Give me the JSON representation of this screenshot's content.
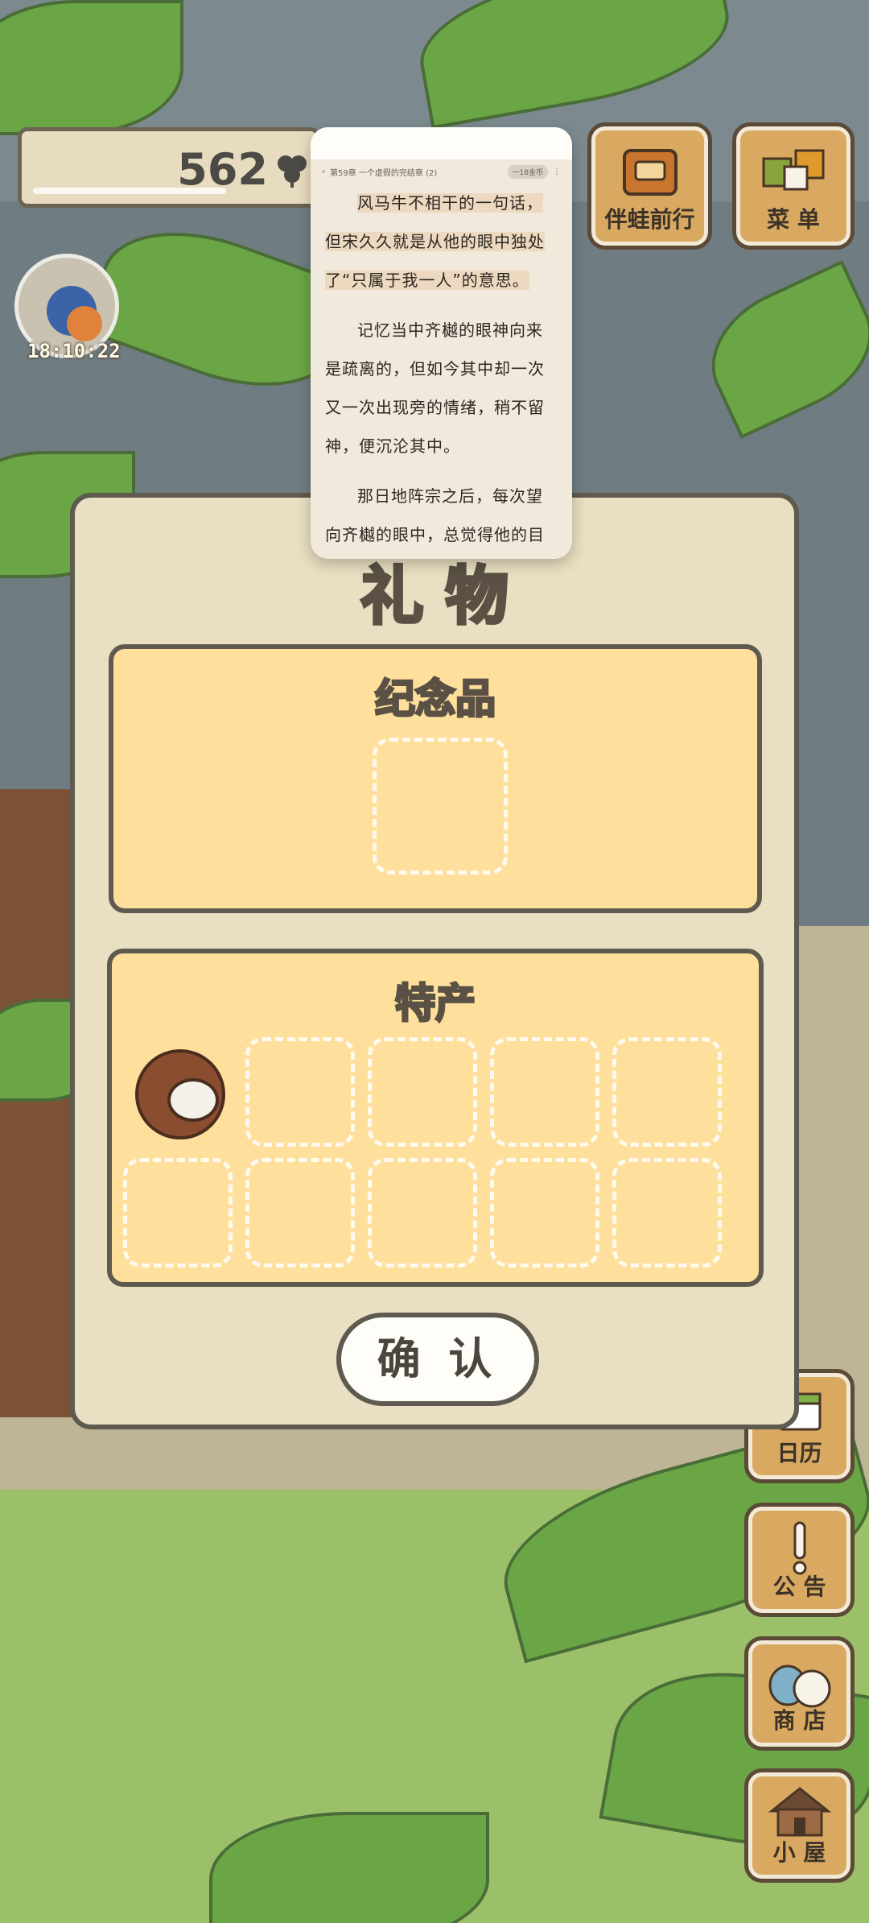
{
  "hud": {
    "clover_count": "562",
    "clover_icon": "clover-icon",
    "timer": "18:10:22",
    "buttons": {
      "travel": "伴蛙前行",
      "menu": "菜 单",
      "calendar": "日历",
      "notice": "公 告",
      "shop": "商 店",
      "house": "小 屋"
    }
  },
  "reader": {
    "chapter": "第59章 一个虚假的完结章 (2)",
    "nav_badge": "一18金币",
    "paragraphs": [
      "风马牛不相干的一句话，但宋久久就是从他的眼中独处了“只属于我一人”的意思。",
      "记忆当中齐樾的眼神向来是疏离的，但如今其中却一次又一次出现旁的情绪，稍不留神，便沉沦其中。",
      "那日地阵宗之后，每次望向齐樾的眼中，总觉得他的目光事实的不像话"
    ]
  },
  "dialog": {
    "title": "礼 物",
    "souvenir_title": "纪念品",
    "specialty_title": "特产",
    "specialty_items": [
      "coconut"
    ],
    "confirm_label": "确 认"
  }
}
